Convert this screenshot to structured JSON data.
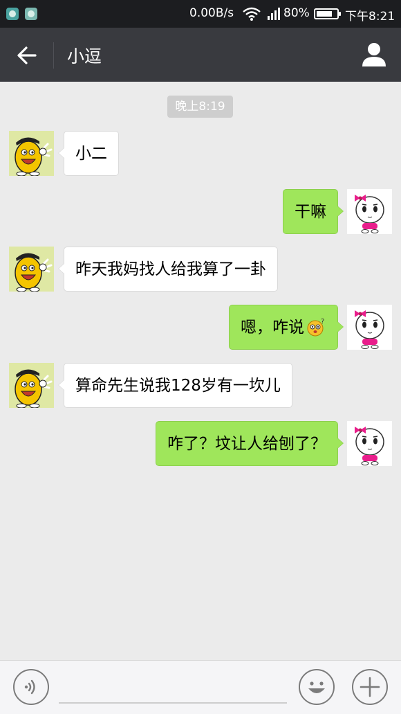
{
  "status_bar": {
    "net_speed": "0.00B/s",
    "battery_percent": "80%",
    "time": "下午8:21",
    "battery_level": 0.8
  },
  "header": {
    "title": "小逗",
    "back_icon": "arrow-left-icon",
    "profile_icon": "person-icon"
  },
  "chat": {
    "timestamp": "晚上8:19",
    "messages": [
      {
        "side": "left",
        "text": "小二"
      },
      {
        "side": "right",
        "text": "干嘛"
      },
      {
        "side": "left",
        "text": "昨天我妈找人给我算了一卦"
      },
      {
        "side": "right",
        "text": "嗯，咋说",
        "emoji": "confused-face-emoji"
      },
      {
        "side": "left",
        "text": "算命先生说我128岁有一坎儿"
      },
      {
        "side": "right",
        "text": "咋了？坟让人给刨了？"
      }
    ]
  },
  "input_bar": {
    "voice_icon": "voice-icon",
    "emoji_icon": "smiley-icon",
    "plus_icon": "plus-icon",
    "placeholder": ""
  },
  "colors": {
    "title_bar": "#393a3f",
    "status_bar": "#1c1d20",
    "background": "#ebebeb",
    "bubble_sent": "#9fe65b",
    "bubble_received": "#ffffff"
  }
}
